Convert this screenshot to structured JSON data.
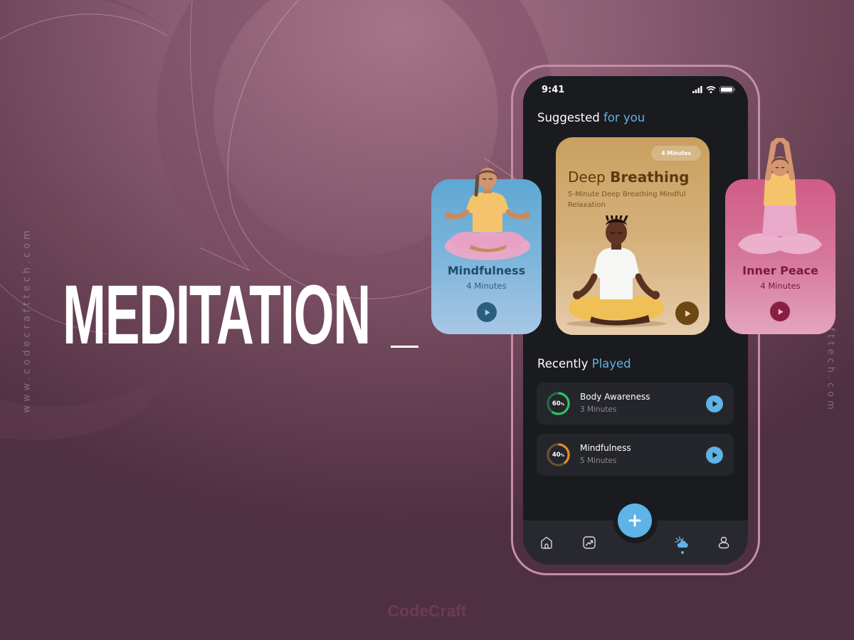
{
  "hero": {
    "title": "MEDITATION",
    "side_url": "www.codecrafttech.com"
  },
  "brand": "CodeCraft",
  "colors": {
    "accent_blue": "#5fb3e6",
    "phone_bg": "#1a1b1f",
    "frame": "#c58ea8",
    "progress_green": "#2ec46a",
    "progress_orange": "#e0902a"
  },
  "phone": {
    "status_bar": {
      "time": "9:41",
      "icons": [
        "signal-icon",
        "wifi-icon",
        "battery-icon"
      ]
    },
    "suggested": {
      "title_plain": "Suggested",
      "title_accent": "for you",
      "featured": {
        "badge": "4 Minutes",
        "title_light": "Deep",
        "title_bold": "Breathing",
        "subtitle": "5-Minute Deep Breathing Mindful Relaxation",
        "play_icon": "play-icon"
      },
      "side_cards": [
        {
          "title": "Mindfulness",
          "duration": "4 Minutes",
          "play_icon": "play-icon"
        },
        {
          "title": "Inner Peace",
          "duration": "4 Minutes",
          "play_icon": "play-icon"
        }
      ]
    },
    "recent": {
      "title_plain": "Recently",
      "title_accent": "Played",
      "items": [
        {
          "title": "Body Awareness",
          "duration": "3 Minutes",
          "progress": 60,
          "progress_label": "60",
          "unit": "%"
        },
        {
          "title": "Mindfulness",
          "duration": "5 Minutes",
          "progress": 40,
          "progress_label": "40",
          "unit": "%"
        }
      ]
    },
    "tab_bar": {
      "items": [
        {
          "icon": "home-icon",
          "active": false
        },
        {
          "icon": "chart-icon",
          "active": false
        },
        {
          "icon": "add-icon",
          "active": false
        },
        {
          "icon": "weather-icon",
          "active": true
        },
        {
          "icon": "profile-icon",
          "active": false
        }
      ]
    }
  }
}
